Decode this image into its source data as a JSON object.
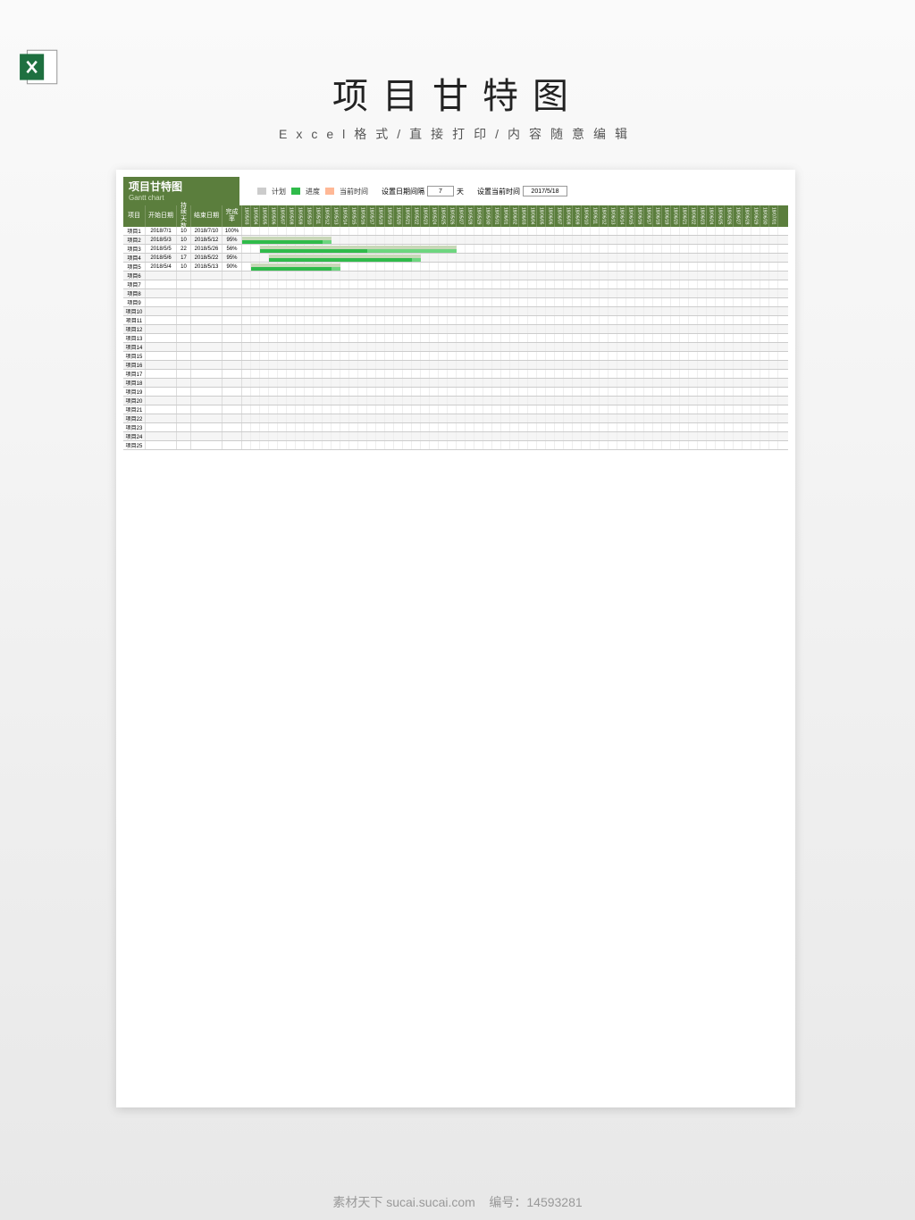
{
  "page": {
    "title": "项目甘特图",
    "subtitle": "Excel格式/直接打印/内容随意编辑"
  },
  "header": {
    "chart_title": "项目甘特图",
    "chart_subtitle": "Gantt chart"
  },
  "legend": {
    "plan": "计划",
    "progress": "进度",
    "current": "当前时间"
  },
  "settings": {
    "interval_label": "设置日期间隔",
    "interval_value": "7",
    "interval_unit": "天",
    "current_label": "设置当前时间",
    "current_value": "2017/5/18"
  },
  "columns": {
    "project": "项目",
    "start": "开始日期",
    "days": "持续天数",
    "end": "结束日期",
    "completion": "完成率"
  },
  "footer": {
    "site": "素材天下 sucai.sucai.com",
    "id_label": "编号：",
    "id_value": "14593281"
  },
  "chart_data": {
    "type": "gantt",
    "title": "项目甘特图",
    "date_axis_start": "18/05/03",
    "date_columns": [
      "18/05/03",
      "18/05/04",
      "18/05/05",
      "18/05/06",
      "18/05/07",
      "18/05/08",
      "18/05/09",
      "18/05/10",
      "18/05/11",
      "18/05/12",
      "18/05/13",
      "18/05/14",
      "18/05/15",
      "18/05/16",
      "18/05/17",
      "18/05/18",
      "18/05/19",
      "18/05/20",
      "18/05/21",
      "18/05/22",
      "18/05/23",
      "18/05/24",
      "18/05/25",
      "18/05/26",
      "18/05/27",
      "18/05/28",
      "18/05/29",
      "18/05/30",
      "18/05/31",
      "18/06/01",
      "18/06/02",
      "18/06/03",
      "18/06/04",
      "18/06/05",
      "18/06/06",
      "18/06/07",
      "18/06/08",
      "18/06/09",
      "18/06/10",
      "18/06/11",
      "18/06/12",
      "18/06/13",
      "18/06/14",
      "18/06/15",
      "18/06/16",
      "18/06/17",
      "18/06/18",
      "18/06/19",
      "18/06/20",
      "18/06/21",
      "18/06/22",
      "18/06/23",
      "18/06/24",
      "18/06/25",
      "18/06/26",
      "18/06/27",
      "18/06/28",
      "18/06/29",
      "18/06/30",
      "18/07/01"
    ],
    "rows": [
      {
        "name": "项目1",
        "start": "2018/7/1",
        "days": 10,
        "end": "2018/7/10",
        "completion": "100%",
        "bar_start": 0,
        "bar_plan": 0,
        "bar_prog": 0
      },
      {
        "name": "项目2",
        "start": "2018/5/3",
        "days": 10,
        "end": "2018/5/12",
        "completion": "95%",
        "bar_start": 0,
        "bar_plan": 10,
        "bar_prog": 9
      },
      {
        "name": "项目3",
        "start": "2018/5/5",
        "days": 22,
        "end": "2018/5/26",
        "completion": "56%",
        "bar_start": 2,
        "bar_plan": 22,
        "bar_prog": 12
      },
      {
        "name": "项目4",
        "start": "2018/5/6",
        "days": 17,
        "end": "2018/5/22",
        "completion": "95%",
        "bar_start": 3,
        "bar_plan": 17,
        "bar_prog": 16
      },
      {
        "name": "项目5",
        "start": "2018/5/4",
        "days": 10,
        "end": "2018/5/13",
        "completion": "90%",
        "bar_start": 1,
        "bar_plan": 10,
        "bar_prog": 9
      },
      {
        "name": "项目6"
      },
      {
        "name": "项目7"
      },
      {
        "name": "项目8"
      },
      {
        "name": "项目9"
      },
      {
        "name": "项目10"
      },
      {
        "name": "项目11"
      },
      {
        "name": "项目12"
      },
      {
        "name": "项目13"
      },
      {
        "name": "项目14"
      },
      {
        "name": "项目15"
      },
      {
        "name": "项目16"
      },
      {
        "name": "项目17"
      },
      {
        "name": "项目18"
      },
      {
        "name": "项目19"
      },
      {
        "name": "项目20"
      },
      {
        "name": "项目21"
      },
      {
        "name": "项目22"
      },
      {
        "name": "项目23"
      },
      {
        "name": "项目24"
      },
      {
        "name": "项目25"
      }
    ]
  }
}
